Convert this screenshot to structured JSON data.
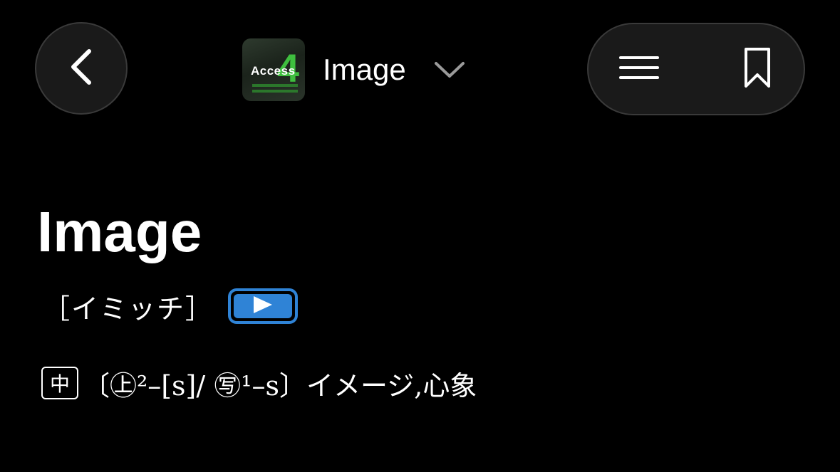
{
  "header": {
    "title": "Image",
    "book_icon": {
      "label": "Access",
      "numeral": "4"
    }
  },
  "icons": {
    "back": "chevron-left-icon",
    "dropdown": "chevron-down-icon",
    "menu": "menu-icon",
    "bookmark": "bookmark-icon",
    "play": "play-icon"
  },
  "entry": {
    "word": "Image",
    "pronunciation": "［イミッチ］",
    "level_badge": "中",
    "definition": "〔㊤²–[s]/ ㊢¹–s〕イメージ,心象"
  },
  "colors": {
    "background": "#000000",
    "button_bg": "#1a1a1a",
    "button_border": "#3a3a3a",
    "accent_blue": "#2f83d6",
    "book_green": "#3fbf3f",
    "chevron_gray": "#9a9a9a"
  }
}
